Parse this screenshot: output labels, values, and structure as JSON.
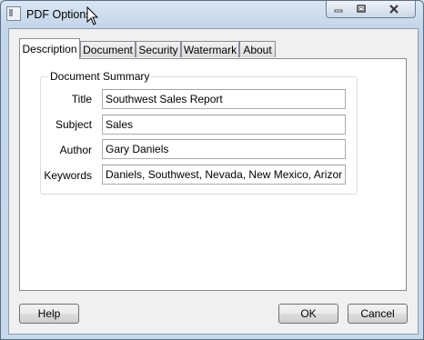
{
  "window": {
    "title": "PDF Options",
    "controls": {
      "minimize_icon": "minimize-icon",
      "maximize_icon": "maximize-icon",
      "close_icon": "close-icon"
    }
  },
  "tabs": [
    {
      "label": "Description",
      "active": true
    },
    {
      "label": "Document",
      "active": false
    },
    {
      "label": "Security",
      "active": false
    },
    {
      "label": "Watermark",
      "active": false
    },
    {
      "label": "About",
      "active": false
    }
  ],
  "summary": {
    "legend": "Document Summary",
    "fields": [
      {
        "label": "Title",
        "value": "Southwest Sales Report"
      },
      {
        "label": "Subject",
        "value": "Sales"
      },
      {
        "label": "Author",
        "value": "Gary Daniels"
      },
      {
        "label": "Keywords",
        "value": "Daniels, Southwest, Nevada, New Mexico, Arizona"
      }
    ]
  },
  "buttons": {
    "help": "Help",
    "ok": "OK",
    "cancel": "Cancel"
  },
  "colors": {
    "chrome": "#c7d8ea",
    "client": "#f0f0f0",
    "border": "#898c95"
  }
}
